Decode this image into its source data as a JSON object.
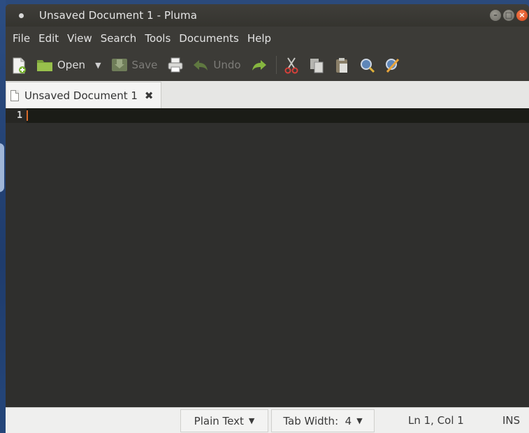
{
  "window": {
    "title": "Unsaved Document 1 - Pluma"
  },
  "menu": [
    "File",
    "Edit",
    "View",
    "Search",
    "Tools",
    "Documents",
    "Help"
  ],
  "toolbar": {
    "new_icon": "new-document-icon",
    "open_label": "Open",
    "save_label": "Save",
    "undo_label": "Undo"
  },
  "tabs": [
    {
      "label": "Unsaved Document 1",
      "close_icon": "✖"
    }
  ],
  "editor": {
    "line_numbers": [
      "1"
    ]
  },
  "status": {
    "language": "Plain Text",
    "tab_width": "Tab Width:  4",
    "position": "Ln 1, Col 1",
    "mode": "INS"
  },
  "colors": {
    "editor_bg": "#2f2f2d",
    "current_line": "#1b1c17",
    "caret": "#d86a2b",
    "chrome": "#3c3b37",
    "close_button": "#e0541f"
  }
}
